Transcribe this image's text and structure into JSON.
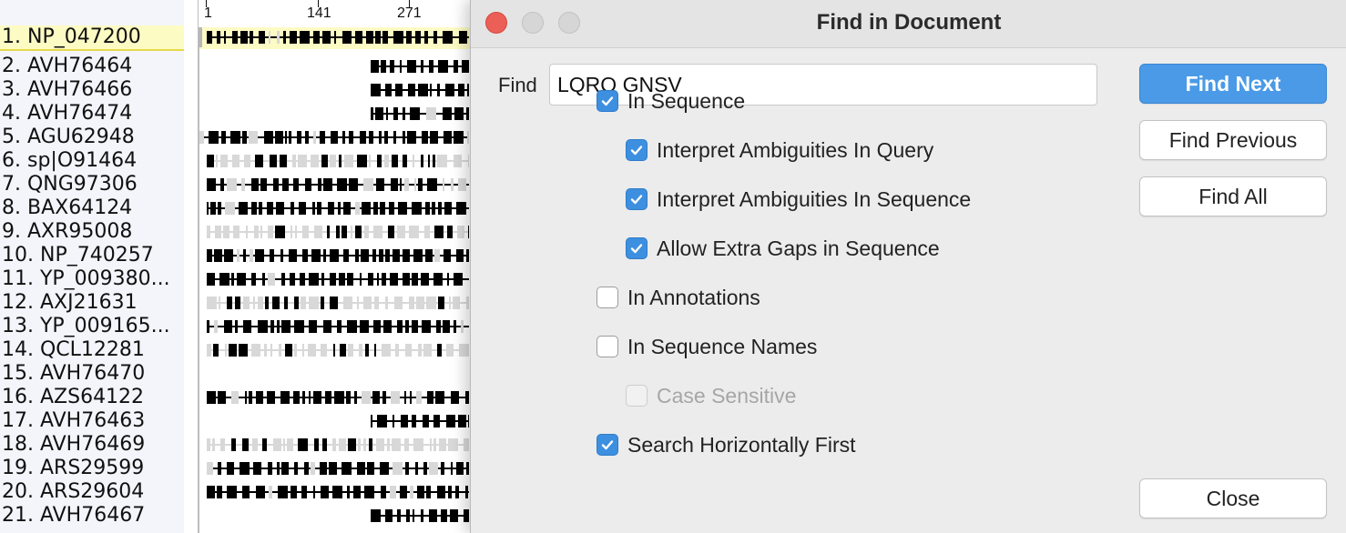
{
  "ruler": {
    "ticks": [
      "1",
      "141",
      "271"
    ]
  },
  "sequences": [
    "1. NP_047200",
    "2. AVH76464",
    "3. AVH76466",
    "4. AVH76474",
    "5. AGU62948",
    "6. sp|O91464",
    "7. QNG97306",
    "8. BAX64124",
    "9. AXR95008",
    "10. NP_740257",
    "11. YP_009380...",
    "12. AXJ21631",
    "13. YP_009165...",
    "14. QCL12281",
    "15. AVH76470",
    "16. AZS64122",
    "17. AVH76463",
    "18. AVH76469",
    "19. ARS29599",
    "20. ARS29604",
    "21. AVH76467"
  ],
  "dialog": {
    "title": "Find in Document",
    "find_label": "Find",
    "find_value": "LQRQ GNSV",
    "options": [
      {
        "label": "In Sequence",
        "checked": true,
        "enabled": true,
        "indent": 0
      },
      {
        "label": "Interpret Ambiguities In Query",
        "checked": true,
        "enabled": true,
        "indent": 1
      },
      {
        "label": "Interpret Ambiguities In Sequence",
        "checked": true,
        "enabled": true,
        "indent": 1
      },
      {
        "label": "Allow Extra Gaps in Sequence",
        "checked": true,
        "enabled": true,
        "indent": 1
      },
      {
        "label": "In Annotations",
        "checked": false,
        "enabled": true,
        "indent": 0
      },
      {
        "label": "In Sequence Names",
        "checked": false,
        "enabled": true,
        "indent": 0
      },
      {
        "label": "Case Sensitive",
        "checked": false,
        "enabled": false,
        "indent": 1
      },
      {
        "label": "Search Horizontally First",
        "checked": true,
        "enabled": true,
        "indent": 0
      }
    ],
    "buttons": {
      "find_next": "Find Next",
      "find_previous": "Find Previous",
      "find_all": "Find All",
      "close": "Close"
    }
  },
  "colors": {
    "accent": "#4a9ae7",
    "selected_row": "#fdfbc4",
    "close_light": "#ec5f57"
  }
}
